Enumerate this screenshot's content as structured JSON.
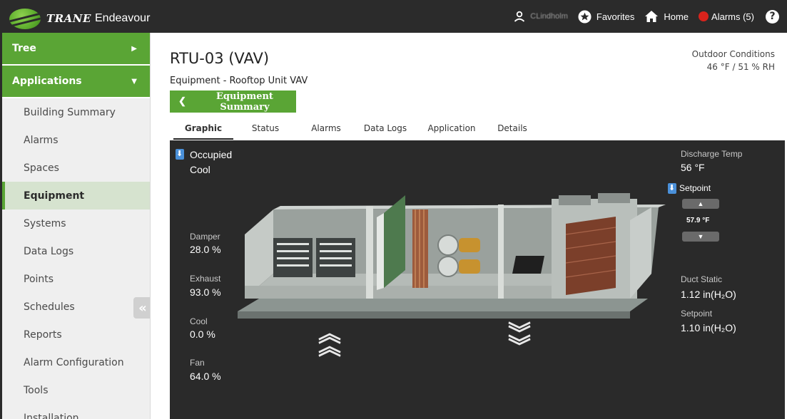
{
  "topbar": {
    "brand": "TRANE",
    "app_name": "Endeavour",
    "user_name": "CLindholm",
    "favorites": "Favorites",
    "home": "Home",
    "alarms": "Alarms (5)",
    "help": "?"
  },
  "sidebar": {
    "sections": [
      {
        "label": "Tree",
        "caret": "▶"
      },
      {
        "label": "Applications",
        "caret": "▼"
      }
    ],
    "items": [
      {
        "label": "Building Summary"
      },
      {
        "label": "Alarms"
      },
      {
        "label": "Spaces"
      },
      {
        "label": "Equipment"
      },
      {
        "label": "Systems"
      },
      {
        "label": "Data Logs"
      },
      {
        "label": "Points"
      },
      {
        "label": "Schedules"
      },
      {
        "label": "Reports"
      },
      {
        "label": "Alarm Configuration"
      },
      {
        "label": "Tools"
      },
      {
        "label": "Installation"
      }
    ],
    "active_item": "Equipment",
    "collapse": "«"
  },
  "header": {
    "title": "RTU-03 (VAV)",
    "subtitle": "Equipment - Rooftop Unit VAV",
    "back_button": "Equipment Summary",
    "outdoor_title": "Outdoor Conditions",
    "outdoor_value": "46 °F / 51 %  RH"
  },
  "tabs": [
    {
      "label": "Graphic"
    },
    {
      "label": "Status"
    },
    {
      "label": "Alarms"
    },
    {
      "label": "Data Logs"
    },
    {
      "label": "Application"
    },
    {
      "label": "Details"
    }
  ],
  "active_tab": "Graphic",
  "graphic": {
    "mode_occupied": "Occupied",
    "mode_cool": "Cool",
    "damper_label": "Damper",
    "damper_value": "28.0 %",
    "exhaust_label": "Exhaust",
    "exhaust_value": "93.0 %",
    "cool_label": "Cool",
    "cool_value": "0.0 %",
    "fan_label": "Fan",
    "fan_value": "64.0 %",
    "discharge_label": "Discharge Temp",
    "discharge_value": "56 °F",
    "setpoint_label": "Setpoint",
    "setpoint_value": "57.9 °F",
    "duct_static_label": "Duct Static",
    "duct_static_value": "1.12 in(H₂O)",
    "duct_setpoint_label": "Setpoint",
    "duct_setpoint_value": "1.10 in(H₂O)"
  },
  "colors": {
    "brand_green": "#5aa535",
    "topbar_bg": "#2b2b2b",
    "panel_bg": "#2a2a2a",
    "alarm_red": "#d9231c",
    "info_blue": "#4a90d9"
  }
}
